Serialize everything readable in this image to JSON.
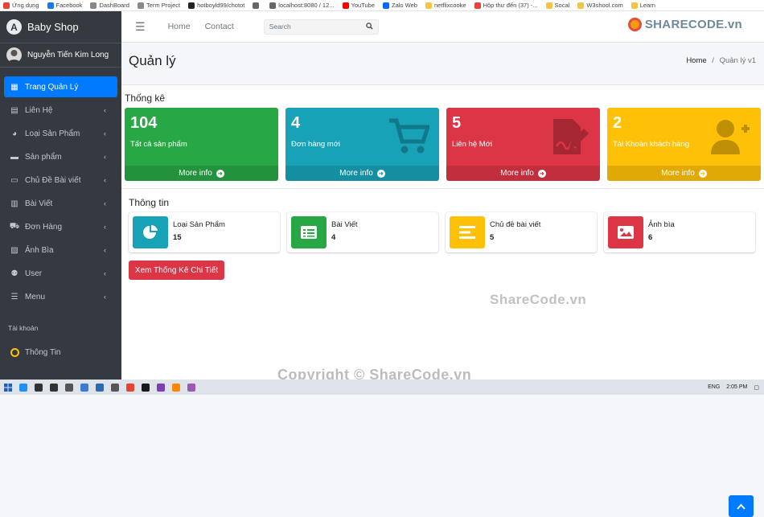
{
  "bookmarks": [
    {
      "label": "Ứng dụng",
      "color": "#ea4335"
    },
    {
      "label": "Facebook",
      "color": "#1877f2"
    },
    {
      "label": "DashBoard",
      "color": "#888888"
    },
    {
      "label": "Term Project",
      "color": "#888888"
    },
    {
      "label": "hotboyld99/chotot",
      "color": "#222222"
    },
    {
      "label": "",
      "color": "#666666"
    },
    {
      "label": "localhost:8080 / 12...",
      "color": "#666666"
    },
    {
      "label": "YouTube",
      "color": "#ff0000"
    },
    {
      "label": "Zalo Web",
      "color": "#0068ff"
    },
    {
      "label": "netflixcooke",
      "color": "#f4c542"
    },
    {
      "label": "Hộp thư đến (37) -...",
      "color": "#ea4335"
    },
    {
      "label": "Socal",
      "color": "#f4c542"
    },
    {
      "label": "W3shool.com",
      "color": "#f4c542"
    },
    {
      "label": "Learn",
      "color": "#f4c542"
    }
  ],
  "brand": {
    "name": "Baby Shop",
    "logo_letter": "A"
  },
  "user": {
    "name": "Nguyễn Tiến Kim Long"
  },
  "sidebar": {
    "items": [
      {
        "label": "Trang Quản Lý",
        "icon": "▦",
        "active": true,
        "chevron": false
      },
      {
        "label": "Liên Hệ",
        "icon": "▤",
        "active": false,
        "chevron": true
      },
      {
        "label": "Loại Sản Phẩm",
        "icon": "◕",
        "active": false,
        "chevron": true
      },
      {
        "label": "Sản phẩm",
        "icon": "▬",
        "active": false,
        "chevron": true
      },
      {
        "label": "Chủ Đề Bài viết",
        "icon": "▭",
        "active": false,
        "chevron": true
      },
      {
        "label": "Bài Viết",
        "icon": "▥",
        "active": false,
        "chevron": true
      },
      {
        "label": "Đơn Hàng",
        "icon": "⛟",
        "active": false,
        "chevron": true
      },
      {
        "label": "Ảnh Bìa",
        "icon": "▨",
        "active": false,
        "chevron": true
      },
      {
        "label": "User",
        "icon": "⚉",
        "active": false,
        "chevron": true
      },
      {
        "label": "Menu",
        "icon": "☰",
        "active": false,
        "chevron": true
      }
    ],
    "section_header": "Tài khoản",
    "info_item": "Thông Tin",
    "chevron_glyph": "‹"
  },
  "topnav": {
    "menu_icon": "☰",
    "links": [
      "Home",
      "Contact"
    ],
    "search_placeholder": "Search"
  },
  "watermark_logo": "SHARECODE.vn",
  "page": {
    "title": "Quản lý",
    "breadcrumb": {
      "home": "Home",
      "separator": "/",
      "current": "Quản lý v1"
    }
  },
  "stats": {
    "title": "Thống kê",
    "footer_label": "More info",
    "cards": [
      {
        "number": "104",
        "label": "Tất cả sản phẩm",
        "color": "#28a745",
        "icon": "none"
      },
      {
        "number": "4",
        "label": "Đơn hàng mới",
        "color": "#17a2b8",
        "icon": "cart-icon"
      },
      {
        "number": "5",
        "label": "Liên hệ Mới",
        "color": "#dc3545",
        "icon": "file-signature-icon"
      },
      {
        "number": "2",
        "label": "Tài Khoản khách hàng",
        "color": "#ffc107",
        "icon": "user-plus-icon"
      }
    ]
  },
  "info": {
    "title": "Thông tin",
    "cards": [
      {
        "label": "Loại Sản Phẩm",
        "value": "15",
        "color": "#17a2b8",
        "icon": "pie-chart-icon"
      },
      {
        "label": "Bài Viết",
        "value": "4",
        "color": "#28a745",
        "icon": "list-alt-icon"
      },
      {
        "label": "Chủ đề bài viết",
        "value": "5",
        "color": "#ffc107",
        "icon": "align-icon"
      },
      {
        "label": "Ảnh bìa",
        "value": "6",
        "color": "#dc3545",
        "icon": "image-icon"
      }
    ],
    "detail_button": "Xem Thống Kê Chi Tiết"
  },
  "watermarks": {
    "center": "ShareCode.vn",
    "bottom": "Copyright © ShareCode.vn"
  },
  "taskbar": {
    "apps": [
      {
        "color": "#1e90ff"
      },
      {
        "color": "#333333"
      },
      {
        "color": "#333333"
      },
      {
        "color": "#555555"
      },
      {
        "color": "#3b7bd4"
      },
      {
        "color": "#2b6cb0"
      },
      {
        "color": "#555555"
      },
      {
        "color": "#e94235"
      },
      {
        "color": "#1a1a1a"
      },
      {
        "color": "#7b3fb3"
      },
      {
        "color": "#ff8800"
      },
      {
        "color": "#9b59b6"
      }
    ],
    "lang": "ENG",
    "time": "2:05 PM"
  }
}
